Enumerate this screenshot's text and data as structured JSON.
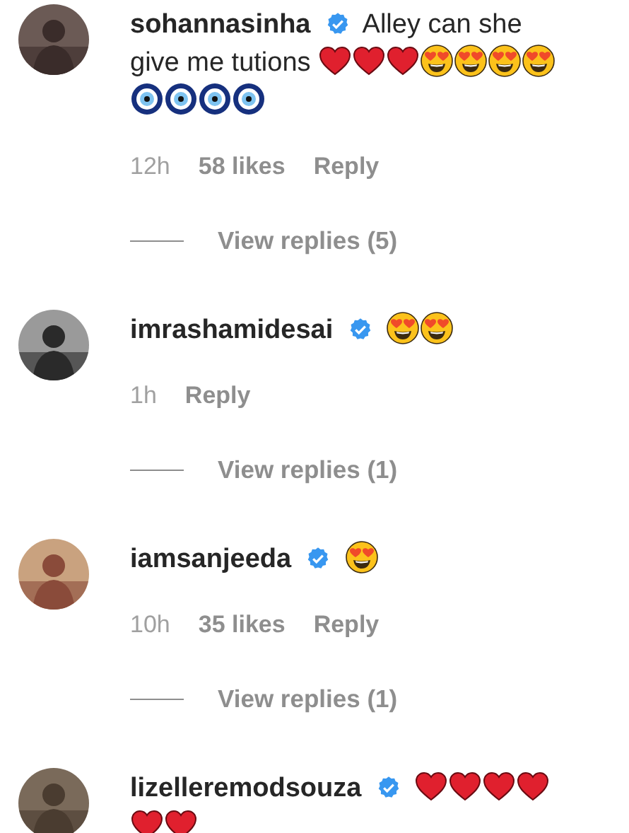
{
  "comments": [
    {
      "username": "sohannasinha",
      "verified": true,
      "text": "Alley can she give me tutions",
      "emojis": [
        {
          "kind": "heart"
        },
        {
          "kind": "heart"
        },
        {
          "kind": "heart"
        },
        {
          "kind": "heart-eyes"
        },
        {
          "kind": "heart-eyes"
        },
        {
          "kind": "heart-eyes"
        },
        {
          "kind": "heart-eyes"
        },
        {
          "kind": "nazar"
        },
        {
          "kind": "nazar"
        },
        {
          "kind": "nazar"
        },
        {
          "kind": "nazar"
        }
      ],
      "time": "12h",
      "likes": "58 likes",
      "reply": "Reply",
      "view_replies": "View replies (5)"
    },
    {
      "username": "imrashamidesai",
      "verified": true,
      "emojis": [
        {
          "kind": "heart-eyes"
        },
        {
          "kind": "heart-eyes"
        }
      ],
      "time": "1h",
      "reply": "Reply",
      "view_replies": "View replies (1)"
    },
    {
      "username": "iamsanjeeda",
      "verified": true,
      "emojis": [
        {
          "kind": "heart-eyes"
        }
      ],
      "time": "10h",
      "likes": "35 likes",
      "reply": "Reply",
      "view_replies": "View replies (1)"
    },
    {
      "username": "lizelleremodsouza",
      "verified": true,
      "emojis": [
        {
          "kind": "heart"
        },
        {
          "kind": "heart"
        },
        {
          "kind": "heart"
        },
        {
          "kind": "heart"
        },
        {
          "kind": "heart"
        },
        {
          "kind": "heart"
        }
      ]
    }
  ]
}
